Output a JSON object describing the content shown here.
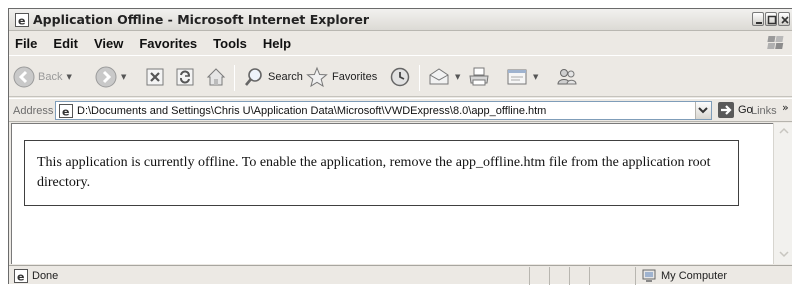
{
  "window": {
    "title": "Application Offline - Microsoft Internet Explorer"
  },
  "menu": [
    "File",
    "Edit",
    "View",
    "Favorites",
    "Tools",
    "Help"
  ],
  "toolbar": {
    "back_label": "Back",
    "search_label": "Search",
    "favorites_label": "Favorites"
  },
  "address": {
    "label": "Address",
    "url": "D:\\Documents and Settings\\Chris U\\Application Data\\Microsoft\\VWDExpress\\8.0\\app_offline.htm",
    "go_label": "Go",
    "links_label": "Links",
    "links_chevron": "»"
  },
  "content": {
    "message": "This application is currently offline. To enable the application, remove the app_offline.htm file from the application root directory."
  },
  "status": {
    "text": "Done",
    "zone": "My Computer"
  },
  "colors": {
    "chrome": "#ece9e4",
    "go_green": "#3aa63a",
    "search_blue": "#3b6fc8",
    "star_gold": "#e8c23a"
  }
}
